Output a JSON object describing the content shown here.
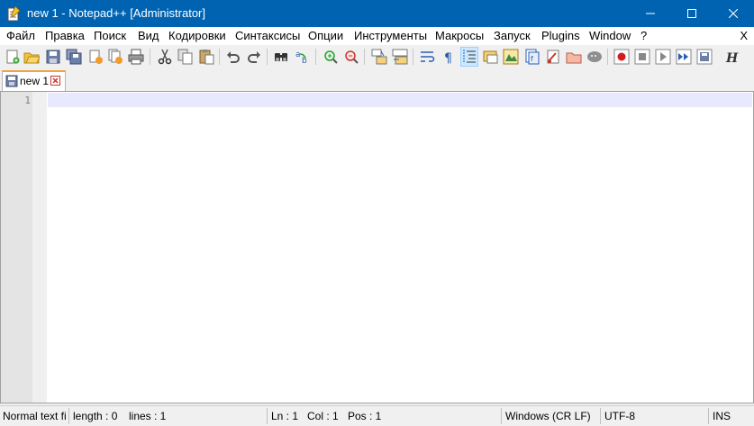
{
  "window": {
    "title": "new 1 - Notepad++ [Administrator]"
  },
  "menu": {
    "items": [
      "Файл",
      "Правка",
      "Поиск",
      "Вид",
      "Кодировки",
      "Синтаксисы",
      "Опции",
      "Инструменты",
      "Макросы",
      "Запуск",
      "Plugins",
      "Window",
      "?"
    ],
    "close_label": "X"
  },
  "toolbar": {
    "icons": [
      "new-file-icon",
      "open-file-icon",
      "save-icon",
      "save-all-icon",
      "close-icon",
      "close-all-icon",
      "print-icon",
      "cut-icon",
      "copy-icon",
      "paste-icon",
      "undo-icon",
      "redo-icon",
      "find-icon",
      "replace-icon",
      "zoom-in-icon",
      "zoom-out-icon",
      "sync-vertical-icon",
      "sync-horizontal-icon",
      "word-wrap-icon",
      "show-all-chars-icon",
      "indent-guide-icon",
      "user-lang-icon",
      "doc-map-icon",
      "function-list-icon",
      "folder-as-workspace-icon",
      "doc-switcher-icon",
      "monitor-icon",
      "record-macro-icon",
      "stop-macro-icon",
      "play-macro-icon",
      "run-macro-multiple-icon",
      "save-macro-icon",
      "html-tag-icon"
    ]
  },
  "tabs": [
    {
      "label": "new 1",
      "active": true
    }
  ],
  "editor": {
    "line_numbers": [
      "1"
    ],
    "current_line_color": "#e8e8ff"
  },
  "status": {
    "doc_type": "Normal text fi",
    "length": "length : 0",
    "lines": "lines : 1",
    "ln": "Ln : 1",
    "col": "Col : 1",
    "pos": "Pos : 1",
    "eol": "Windows (CR LF)",
    "encoding": "UTF-8",
    "mode": "INS"
  },
  "colors": {
    "titlebar": "#0063b1",
    "tab_accent": "#f2a33a"
  }
}
